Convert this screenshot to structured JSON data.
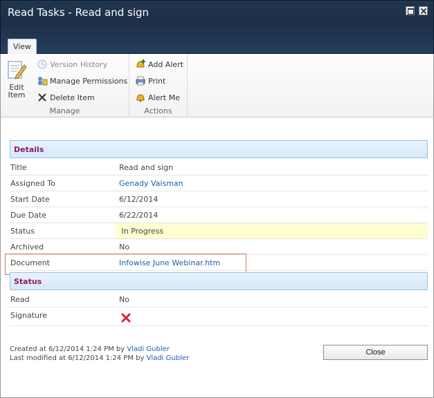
{
  "window": {
    "title": "Read Tasks - Read and sign"
  },
  "ribbon": {
    "tab_label": "View",
    "edit_item_line1": "Edit",
    "edit_item_line2": "Item",
    "version_history": "Version History",
    "manage_permissions": "Manage Permissions",
    "delete_item": "Delete Item",
    "manage_group": "Manage",
    "add_alert": "Add Alert",
    "print": "Print",
    "alert_me": "Alert Me",
    "actions_group": "Actions"
  },
  "details": {
    "heading": "Details",
    "rows": [
      {
        "label": "Title",
        "value": "Read and sign"
      },
      {
        "label": "Assigned To",
        "value": "Genady Vaisman"
      },
      {
        "label": "Start Date",
        "value": "6/12/2014"
      },
      {
        "label": "Due Date",
        "value": "6/22/2014"
      },
      {
        "label": "Status",
        "value": " In Progress"
      },
      {
        "label": "Archived",
        "value": "No"
      },
      {
        "label": "Document",
        "value": "Infowise June Webinar.htm"
      }
    ]
  },
  "status": {
    "heading": "Status",
    "rows": [
      {
        "label": "Read",
        "value": "No"
      },
      {
        "label": "Signature",
        "value": ""
      }
    ],
    "signature_icon": "red-x-icon"
  },
  "footer": {
    "created_prefix": "Created at 6/12/2014 1:24 PM by ",
    "created_by": "Vladi Gubler",
    "modified_prefix": "Last modified at 6/12/2014 1:24 PM by ",
    "modified_by": "Vladi Gubler",
    "close_label": "Close"
  },
  "colors": {
    "title_bar": "#1c3048",
    "section_heading": "#8b1a6b",
    "link": "#1f5fa8",
    "status_highlight": "#fffed0"
  }
}
